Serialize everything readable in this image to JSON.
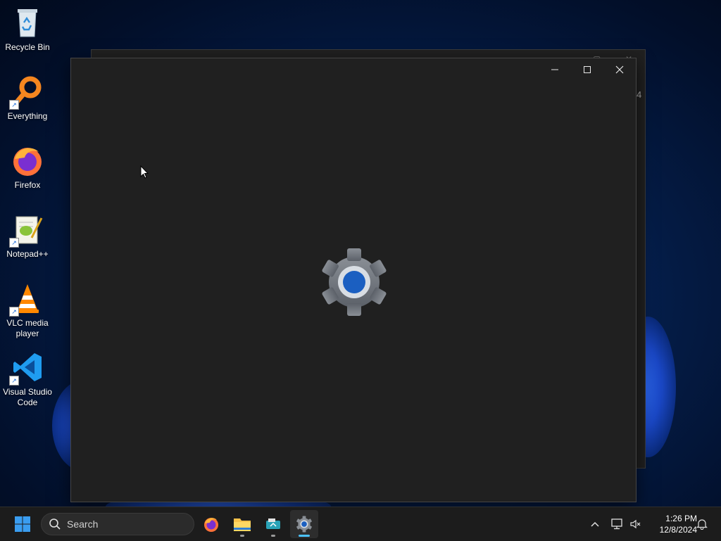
{
  "desktop": {
    "icons": [
      {
        "label": "Recycle Bin",
        "icon": "recycle-bin-icon"
      },
      {
        "label": "Everything",
        "icon": "everything-search-icon"
      },
      {
        "label": "Firefox",
        "icon": "firefox-icon"
      },
      {
        "label": "Notepad++",
        "icon": "notepad-plus-plus-icon"
      },
      {
        "label": "VLC media player",
        "icon": "vlc-icon"
      },
      {
        "label": "Visual Studio Code",
        "icon": "vscode-icon"
      }
    ]
  },
  "background_window": {
    "edge_text": "4"
  },
  "settings_window": {
    "splash_icon": "settings-gear-icon",
    "accent": "#1b5fc1"
  },
  "taskbar": {
    "search_placeholder": "Search",
    "apps": [
      {
        "name": "Firefox",
        "icon": "firefox-icon"
      },
      {
        "name": "File Explorer",
        "icon": "folder-icon"
      },
      {
        "name": "App",
        "icon": "app-icon"
      },
      {
        "name": "Settings",
        "icon": "settings-gear-icon",
        "active": true
      }
    ],
    "clock": {
      "time": "1:26 PM",
      "date": "12/8/2024"
    },
    "accent": "#4cc2ff"
  }
}
